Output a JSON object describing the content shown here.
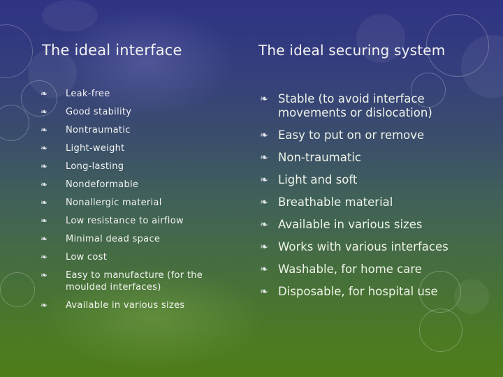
{
  "slide": {
    "bullet_icon": "floral-heart-bullet",
    "bullet_glyph": "❧",
    "colors": {
      "background_top": "#2f3383",
      "background_bottom": "#4e7d1a",
      "text": "#f2f2f2"
    }
  },
  "left": {
    "title": "The ideal interface",
    "items": [
      {
        "label": "Leak-free"
      },
      {
        "label": "Good stability"
      },
      {
        "label": "Nontraumatic"
      },
      {
        "label": "Light-weight"
      },
      {
        "label": "Long-lasting"
      },
      {
        "label": "Nondeformable"
      },
      {
        "label": "Nonallergic material"
      },
      {
        "label": "Low resistance to airflow"
      },
      {
        "label": "Minimal dead space"
      },
      {
        "label": "Low cost"
      },
      {
        "label": "Easy to manufacture (for the moulded interfaces)"
      },
      {
        "label": "Available in various sizes"
      }
    ]
  },
  "right": {
    "title": "The ideal securing system",
    "items": [
      {
        "label": "Stable (to avoid interface movements or dislocation)"
      },
      {
        "label": "Easy to put on or remove"
      },
      {
        "label": "Non-traumatic"
      },
      {
        "label": "Light and soft"
      },
      {
        "label": "Breathable material"
      },
      {
        "label": "Available in various sizes"
      },
      {
        "label": "Works with various interfaces"
      },
      {
        "label": "Washable, for home care"
      },
      {
        "label": "Disposable, for hospital use"
      }
    ]
  }
}
